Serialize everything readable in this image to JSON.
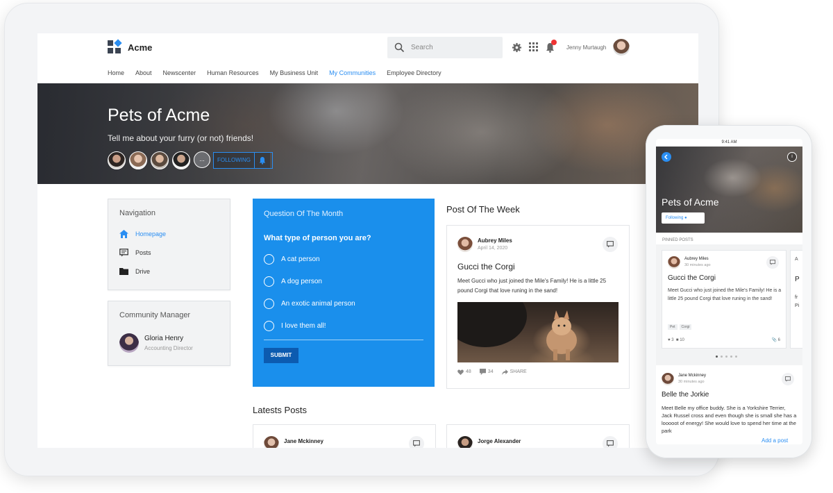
{
  "header": {
    "brand": "Acme",
    "search_placeholder": "Search",
    "user_name": "Jenny Murtaugh"
  },
  "nav": [
    "Home",
    "About",
    "Newscenter",
    "Human Resources",
    "My Business Unit",
    "My Communities",
    "Employee Directory"
  ],
  "nav_active_index": 5,
  "hero": {
    "title": "Pets of Acme",
    "subtitle": "Tell me about your furry (or not) friends!",
    "more": "...",
    "follow_label": "FOLLOWING"
  },
  "sidebar": {
    "title": "Navigation",
    "items": [
      {
        "label": "Homepage",
        "icon": "home-icon",
        "active": true
      },
      {
        "label": "Posts",
        "icon": "posts-icon",
        "active": false
      },
      {
        "label": "Drive",
        "icon": "folder-icon",
        "active": false
      }
    ]
  },
  "manager": {
    "title": "Community Manager",
    "name": "Gloria Henry",
    "role": "Accounting Director"
  },
  "question": {
    "title": "Question Of The Month",
    "text": "What type of person you are?",
    "options": [
      "A cat person",
      "A dog person",
      "An exotic animal person",
      "I love them all!"
    ],
    "submit": "SUBMIT"
  },
  "post_of_week": {
    "section_title": "Post Of The Week",
    "author": "Aubrey Miles",
    "date": "April 14, 2020",
    "title": "Gucci the Corgi",
    "body": "Meet Gucci who just joined the Mile's Family! He is a little 25 pound Corgi that love runing in the sand!",
    "likes": "48",
    "comments": "34",
    "share": "SHARE"
  },
  "latest": {
    "section_title": "Latests Posts",
    "posts": [
      {
        "author": "Jane Mckinney"
      },
      {
        "author": "Jorge Alexander"
      }
    ]
  },
  "phone": {
    "time": "9:41 AM",
    "hero_title": "Pets of Acme",
    "follow_label": "Following",
    "info": "i",
    "pinned_label": "PINNED POSTS",
    "pinned": {
      "author": "Aubrey Miles",
      "time": "30 minutes ago",
      "title": "Gucci the Corgi",
      "body": "Meet Gucci who just joined the Mile's Family! He is a little 25 pound Corgi that love runing in the sand!",
      "tags": [
        "Pet",
        "Corgi"
      ],
      "likes": "3",
      "comments": "10",
      "attachments": "6"
    },
    "peek": {
      "author_initial": "A",
      "body_initial_1": "P",
      "body_initial_2": "fr",
      "body_initial_3": "Pi"
    },
    "second": {
      "author": "Jane Mckinney",
      "time": "30 minutes ago",
      "title": "Belle the Jorkie",
      "body": "Meet Belle my office buddy. She is a Yorkshire Terrier, Jack Russel cross and even though she is small she has a looooot of energy! She would love to spend her time at the park"
    },
    "add_post": "Add a post"
  },
  "colors": {
    "accent": "#1a8fec",
    "submit": "#0c5bb0",
    "notification": "#e33333"
  }
}
